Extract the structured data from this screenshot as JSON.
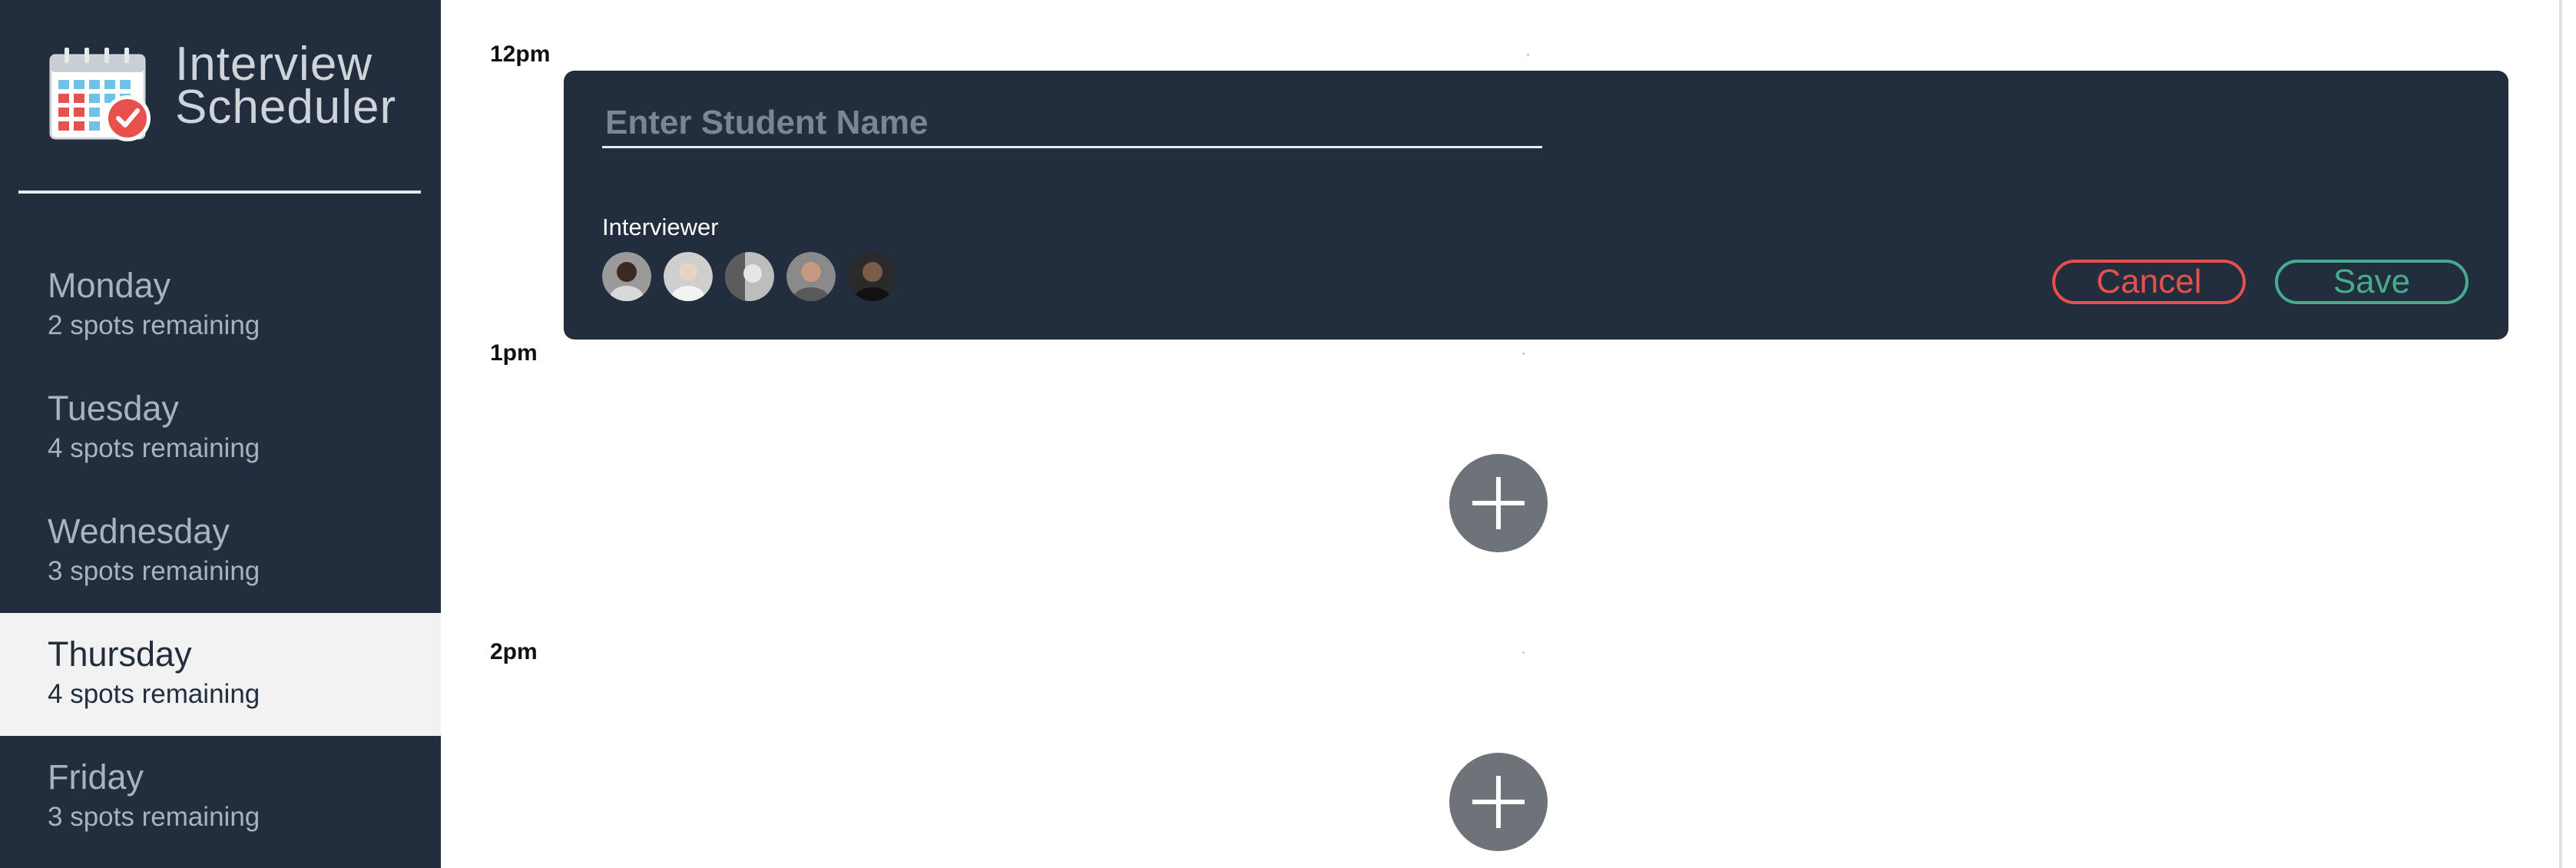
{
  "app": {
    "title_line1": "Interview",
    "title_line2": "Scheduler"
  },
  "days": [
    {
      "name": "Monday",
      "spots": "2 spots remaining",
      "selected": false
    },
    {
      "name": "Tuesday",
      "spots": "4 spots remaining",
      "selected": false
    },
    {
      "name": "Wednesday",
      "spots": "3 spots remaining",
      "selected": false
    },
    {
      "name": "Thursday",
      "spots": "4 spots remaining",
      "selected": true
    },
    {
      "name": "Friday",
      "spots": "3 spots remaining",
      "selected": false
    }
  ],
  "schedule": {
    "times": [
      "12pm",
      "1pm",
      "2pm"
    ]
  },
  "form": {
    "student_placeholder": "Enter Student Name",
    "student_value": "",
    "interviewer_label": "Interviewer",
    "interviewer_count": 5,
    "cancel_label": "Cancel",
    "save_label": "Save"
  },
  "icons": {
    "logo": "calendar-check-icon",
    "add": "plus-icon",
    "avatar": "interviewer-avatar"
  },
  "colors": {
    "sidebar_bg": "#222d3d",
    "selected_day_bg": "#f2f2f2",
    "cancel": "#e6504d",
    "save": "#46ad8c",
    "add_button": "#6e7379",
    "logo_red": "#e6504d",
    "logo_blue": "#6fc1e6"
  }
}
